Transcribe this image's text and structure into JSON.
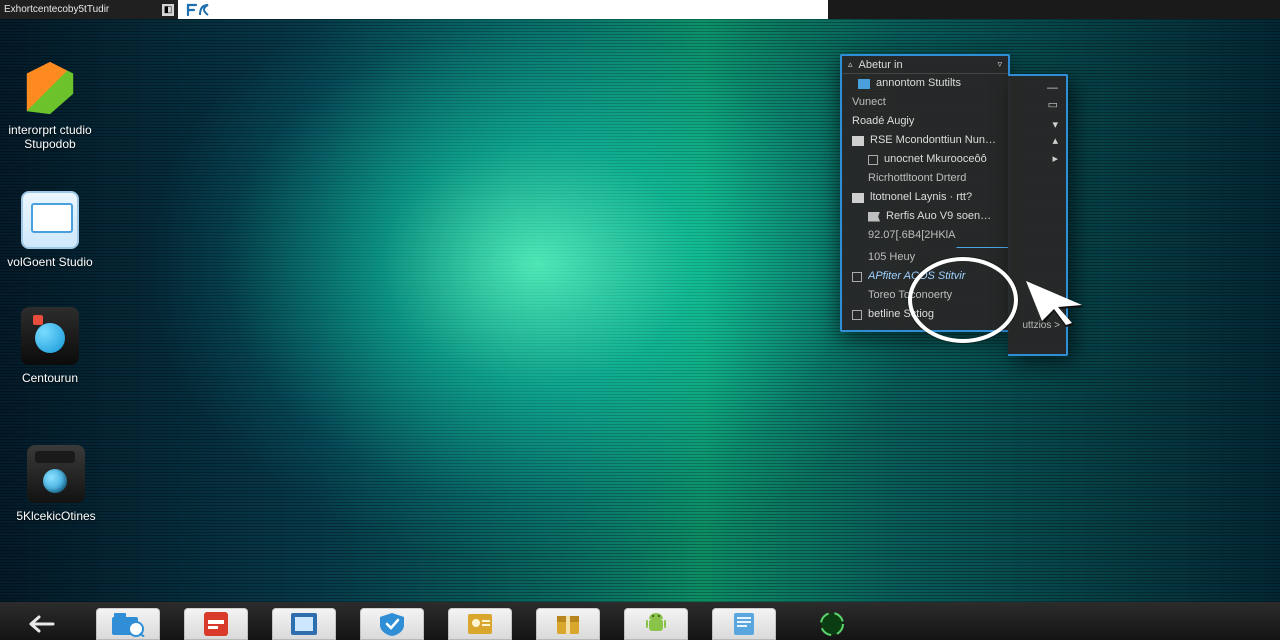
{
  "topbar": {
    "title": "Exhortcentecoby5tTudir"
  },
  "desktop_icons": [
    {
      "label": "interorprt ctudio\nStupodob"
    },
    {
      "label": "volGoent Studio"
    },
    {
      "label": "Centourun"
    },
    {
      "label": "5KlcekicOtines"
    }
  ],
  "panel": {
    "header": "Abetur in",
    "rows": [
      {
        "text": "annontom Stutilts"
      },
      {
        "text": "Vunect"
      },
      {
        "text": "Roadé Augiy"
      },
      {
        "text": "RSE Mcondonttiun Nuner Z…"
      },
      {
        "text": "unocnet Mkurooceôô"
      },
      {
        "text": "Ricrhottltoont Drterd"
      },
      {
        "text": "ltotnonel Laynis · rtt?"
      },
      {
        "text": "Rerfis  Auo   V9 soen…"
      },
      {
        "text": "92.07[.6B4[2HKlA"
      },
      {
        "text": "105 Heuy"
      },
      {
        "text": "APfiter  ACOS Stitvir"
      },
      {
        "text": "Toreo     Toconoerty"
      },
      {
        "text": "betline Sctiog"
      }
    ],
    "ext_caret": "uttzios >"
  },
  "taskbar_items": [
    "back",
    "explorer",
    "pdf",
    "word",
    "shield",
    "id",
    "package",
    "android",
    "notes",
    "orb"
  ]
}
